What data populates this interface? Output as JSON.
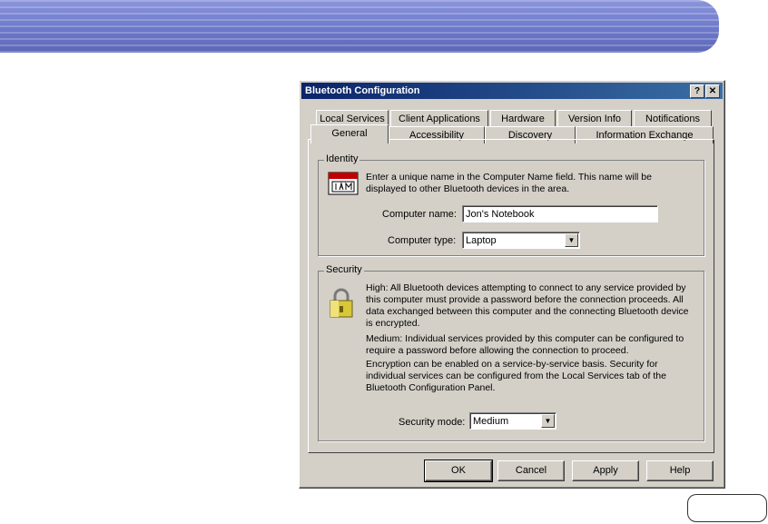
{
  "dialog": {
    "title": "Bluetooth Configuration",
    "help_glyph": "?",
    "close_glyph": "✕"
  },
  "tabs": {
    "row1": [
      "Local Services",
      "Client Applications",
      "Hardware",
      "Version Info",
      "Notifications"
    ],
    "row2": [
      "General",
      "Accessibility",
      "Discovery",
      "Information Exchange"
    ],
    "active": "General"
  },
  "identity": {
    "group_label": "Identity",
    "description": "Enter a unique name in the Computer Name field. This name will be displayed to other Bluetooth devices in the area.",
    "computer_name_label": "Computer name:",
    "computer_name_value": "Jon's Notebook",
    "computer_type_label": "Computer type:",
    "computer_type_value": "Laptop",
    "icon": "name-badge-icon"
  },
  "security": {
    "group_label": "Security",
    "high_text": "High: All Bluetooth devices attempting to connect to any service provided by this computer must provide a password before the connection proceeds. All data exchanged between this computer and the connecting Bluetooth device is encrypted.",
    "medium_text_1": "Medium: Individual services provided by this computer can be configured to require a password before allowing the connection to proceed.",
    "medium_text_2": "Encryption can be enabled on a service-by-service basis. Security for individual services can be configured from the Local Services tab of the Bluetooth Configuration Panel.",
    "mode_label": "Security mode:",
    "mode_value": "Medium",
    "icon": "padlock-icon"
  },
  "buttons": {
    "ok": "OK",
    "cancel": "Cancel",
    "apply": "Apply",
    "help": "Help"
  },
  "colors": {
    "banner": "#6d79c9",
    "titlebar": "#0a246a",
    "dialog_face": "#d4d0c8"
  }
}
